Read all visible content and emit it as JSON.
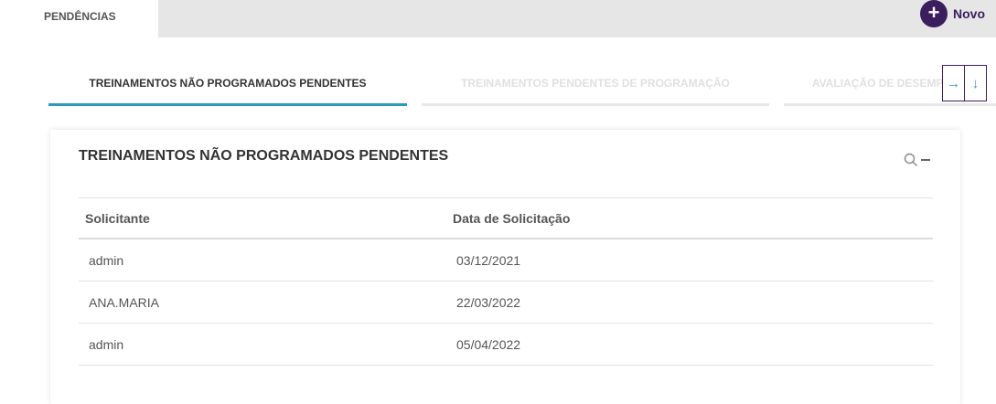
{
  "topbar": {
    "tab_label": "PENDÊNCIAS",
    "new_button_label": "Novo"
  },
  "tabs": [
    {
      "label": "TREINAMENTOS NÃO PROGRAMADOS PENDENTES",
      "active": true
    },
    {
      "label": "TREINAMENTOS PENDENTES DE PROGRAMAÇÃO",
      "active": false
    },
    {
      "label": "AVALIAÇÃO DE DESEMPENHO",
      "active": false
    }
  ],
  "card": {
    "title": "TREINAMENTOS NÃO PROGRAMADOS PENDENTES",
    "columns": [
      "Solicitante",
      "Data de Solicitação"
    ],
    "rows": [
      [
        "admin",
        "03/12/2021"
      ],
      [
        "ANA.MARIA",
        "22/03/2022"
      ],
      [
        "admin",
        "05/04/2022"
      ]
    ]
  },
  "icons": {
    "new": "plus-icon",
    "scroll_right": "arrow-right-icon",
    "scroll_down": "arrow-down-icon",
    "search": "search-icon",
    "collapse": "minus-icon"
  },
  "colors": {
    "brand": "#3b1e5e",
    "accent": "#2a9bbd",
    "topbar_bg": "#e6e6e6"
  }
}
